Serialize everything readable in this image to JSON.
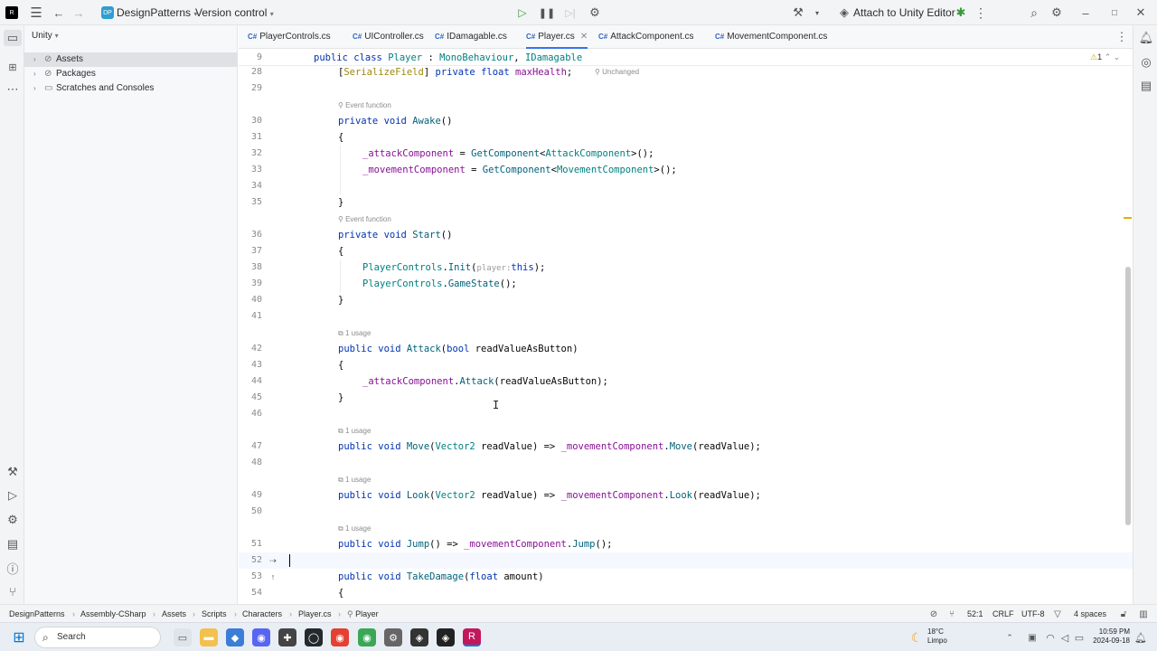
{
  "titlebar": {
    "project_name": "DesignPatterns",
    "project_badge": "DP",
    "vcs": "Version control",
    "attach": "Attach to Unity Editor"
  },
  "project_panel": {
    "title": "Unity",
    "items": [
      "Assets",
      "Packages",
      "Scratches and Consoles"
    ]
  },
  "tabs": [
    "PlayerControls.cs",
    "UIController.cs",
    "IDamagable.cs",
    "Player.cs",
    "AttackComponent.cs",
    "MovementComponent.cs"
  ],
  "active_tab": "Player.cs",
  "editor": {
    "warning_count": "1",
    "hint_unchanged": "Unchanged",
    "hint_event": "Event function",
    "hint_usage": "1 usage",
    "inlay_player": "player:",
    "lines": [
      "9",
      "28",
      "29",
      "30",
      "31",
      "32",
      "33",
      "34",
      "35",
      "36",
      "37",
      "38",
      "39",
      "40",
      "41",
      "42",
      "43",
      "44",
      "45",
      "46",
      "47",
      "48",
      "49",
      "50",
      "51",
      "52",
      "53",
      "54"
    ]
  },
  "statusbar": {
    "breadcrumb": [
      "DesignPatterns",
      "Assembly-CSharp",
      "Assets",
      "Scripts",
      "Characters",
      "Player.cs",
      "Player"
    ],
    "position": "52:1",
    "line_ending": "CRLF",
    "encoding": "UTF-8",
    "indent": "4 spaces"
  },
  "taskbar": {
    "search": "Search",
    "temp": "18°C",
    "weather": "Limpo",
    "time": "10:59 PM",
    "date": "2024-09-18"
  },
  "colors": {
    "keyword": "#0033b3",
    "type": "#008080",
    "function": "#00627a",
    "member": "#871094",
    "annotation": "#9e880d"
  }
}
